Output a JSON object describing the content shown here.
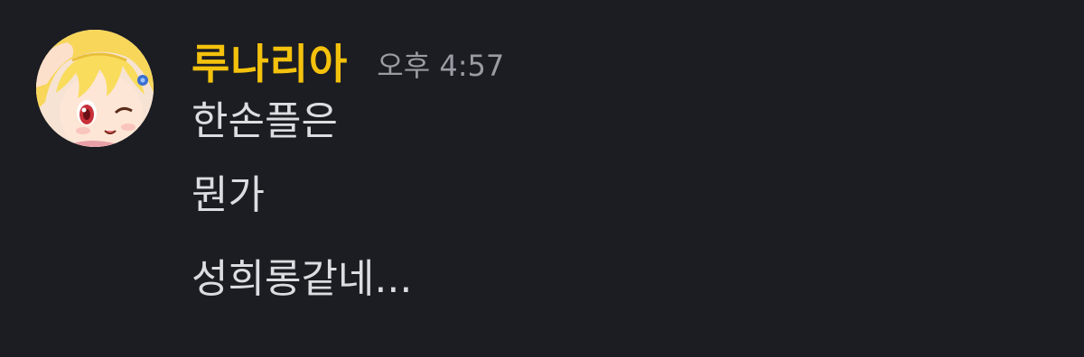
{
  "message": {
    "author": "루나리아",
    "timestamp": "오후 4:57",
    "lines": [
      "한손플은",
      "뭔가",
      "성희롱같네..."
    ],
    "author_color": "#f4c20d",
    "avatar_icon": "anime-girl-avatar"
  }
}
